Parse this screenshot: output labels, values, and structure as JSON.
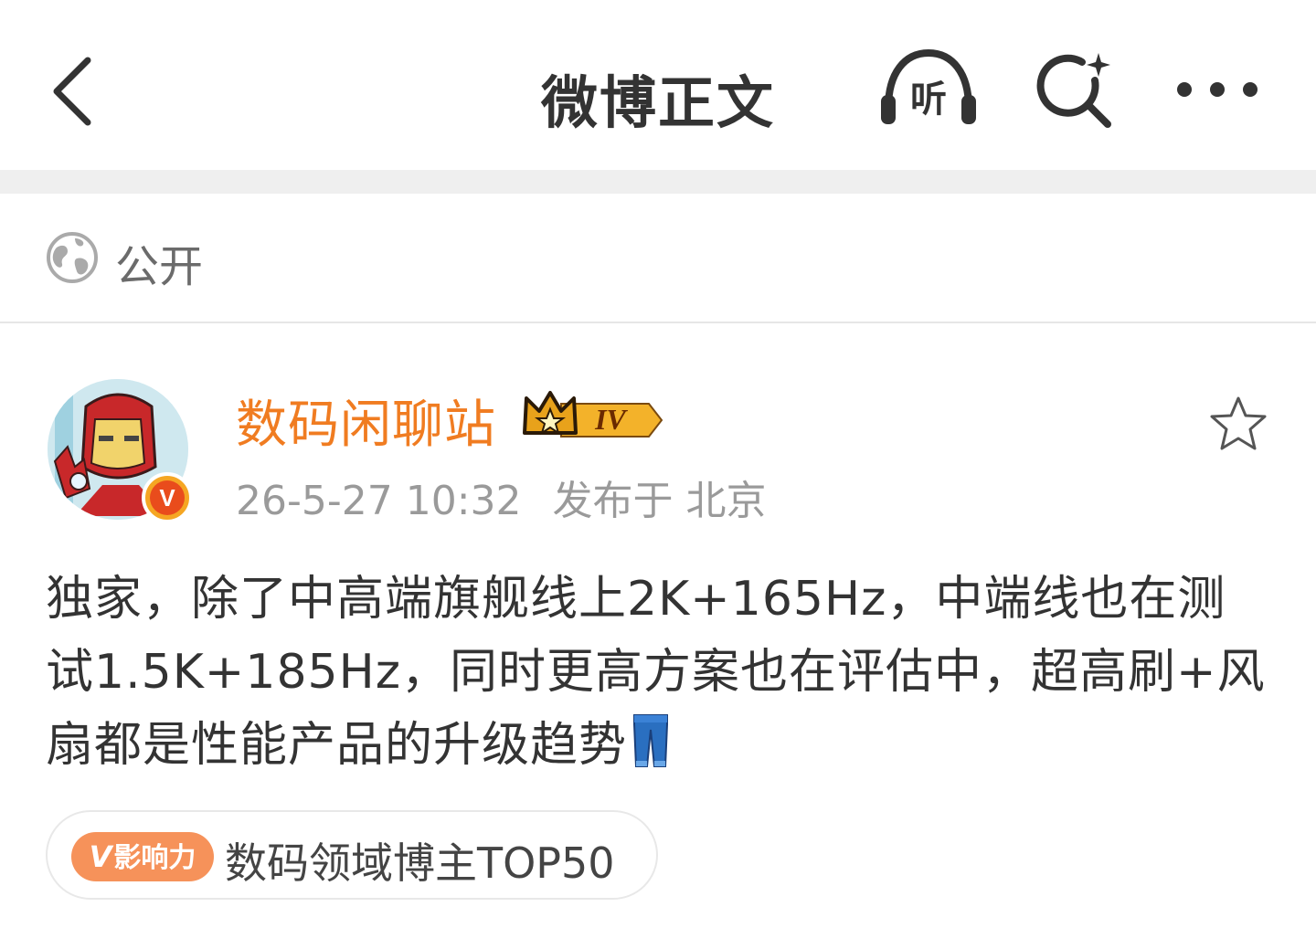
{
  "header": {
    "title": "微博正文",
    "back_icon": "chevron-left-icon",
    "listen_label": "听",
    "search_icon": "search-sparkle-icon",
    "more_icon": "more-dots-icon"
  },
  "visibility": {
    "icon": "globe-icon",
    "label": "公开"
  },
  "post": {
    "author": {
      "name": "数码闲聊站",
      "level_badge": "IV",
      "verified_mark": "V"
    },
    "time": "26-5-27 10:32",
    "location": "发布于 北京",
    "text": "独家，除了中高端旗舰线上2K+165Hz，中端线也在测试1.5K+185Hz，同时更高方案也在评估中，超高刷+风扇都是性能产品的升级趋势",
    "trailing_emoji": "jeans-emoji",
    "favorite_icon": "star-outline-icon"
  },
  "influence_tag": {
    "badge_v": "V",
    "badge_label": "影响力",
    "text": "数码领域博主TOP50"
  },
  "colors": {
    "username": "#f07c21",
    "badge": "#f6925a",
    "text": "#333333",
    "meta": "#9a9a9a"
  }
}
